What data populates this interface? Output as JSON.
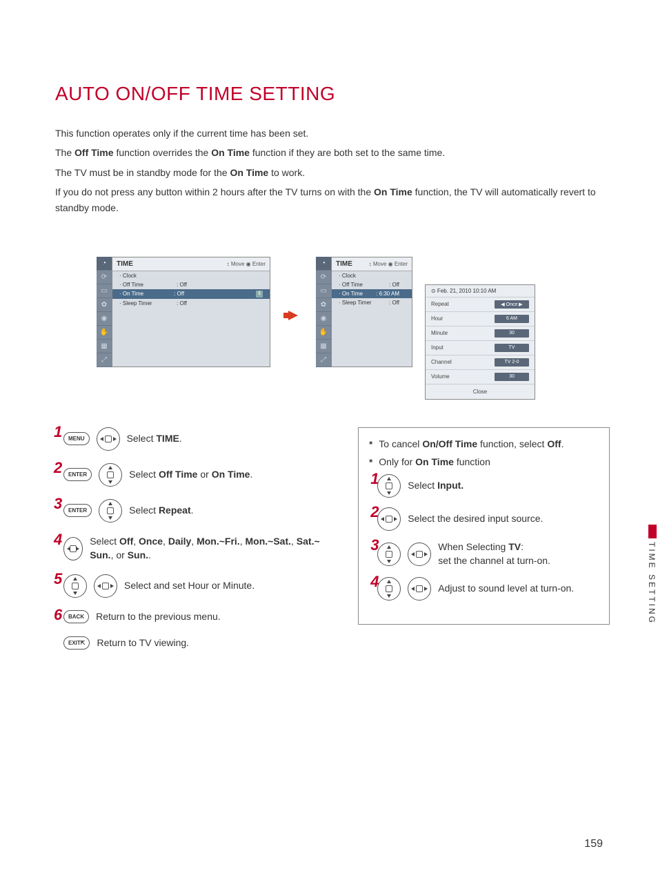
{
  "title": "AUTO ON/OFF TIME SETTING",
  "intro": {
    "l1a": "This function operates only if the current time has been set.",
    "l2a": "The ",
    "l2b": "Off Time",
    "l2c": " function overrides the ",
    "l2d": "On Time",
    "l2e": " function if they are both set to the same time.",
    "l3a": "The TV must be in standby mode for the ",
    "l3b": "On Time",
    "l3c": " to work.",
    "l4a": "If you do not press any button within 2 hours after the TV turns on with the ",
    "l4b": "On Time",
    "l4c": " function, the TV will automatically revert to standby mode."
  },
  "osd": {
    "header": "TIME",
    "nav": "↕ Move   ◉ Enter",
    "items": {
      "clock": "Clock",
      "offtime": "Off Time",
      "ontime": "On Time",
      "sleep": "Sleep Timer"
    },
    "val_off": ": Off",
    "val_on_right": ": 6:30 AM",
    "date": "⊙ Feb. 21, 2010 10:10 AM",
    "side": {
      "repeat_l": "Repeat",
      "repeat_v": "◀   Once   ▶",
      "hour_l": "Hour",
      "hour_v": "6 AM",
      "minute_l": "Minute",
      "minute_v": "30",
      "input_l": "Input",
      "input_v": "TV",
      "channel_l": "Channel",
      "channel_v": "TV 2-0",
      "volume_l": "Volume",
      "volume_v": "30",
      "close": "Close"
    },
    "spin": "⇕"
  },
  "steps": {
    "s1": {
      "btn": "MENU",
      "txt_a": "Select ",
      "txt_b": "TIME",
      "txt_c": "."
    },
    "s2": {
      "btn": "ENTER",
      "txt_a": "Select ",
      "txt_b": "Off Time",
      "txt_c": " or ",
      "txt_d": "On Time",
      "txt_e": "."
    },
    "s3": {
      "btn": "ENTER",
      "txt_a": "Select ",
      "txt_b": "Repeat",
      "txt_c": "."
    },
    "s4": {
      "txt_a": "Select ",
      "b1": "Off",
      "c1": ", ",
      "b2": "Once",
      "c2": ", ",
      "b3": "Daily",
      "c3": ", ",
      "b4": "Mon.~Fri.",
      "c4": ", ",
      "b5": "Mon.~Sat.",
      "c5": ", ",
      "b6": "Sat.~ Sun.",
      "c6": ", or ",
      "b7": "Sun.",
      "c7": "."
    },
    "s5": {
      "txt": "Select and set Hour or Minute."
    },
    "s6": {
      "btn": "BACK",
      "txt": "Return to the previous menu."
    },
    "s7": {
      "btn": "EXIT⇱",
      "txt": "Return to TV viewing."
    },
    "nums": {
      "n1": "1",
      "n2": "2",
      "n3": "3",
      "n4": "4",
      "n5": "5",
      "n6": "6"
    }
  },
  "notes": {
    "n1a": "To cancel ",
    "n1b": "On/Off Time",
    "n1c": " function, select ",
    "n1d": "Off",
    "n1e": ".",
    "n2a": "Only for ",
    "n2b": "On Time",
    "n2c": " function",
    "r1a": "Select ",
    "r1b": "Input.",
    "r2": "Select the desired input source.",
    "r3a": "When Selecting ",
    "r3b": "TV",
    "r3c": ":",
    "r3d": "set the channel at turn-on.",
    "r4": "Adjust to sound level at turn-on."
  },
  "chrome": {
    "tab": "TIME SETTING",
    "page": "159"
  }
}
